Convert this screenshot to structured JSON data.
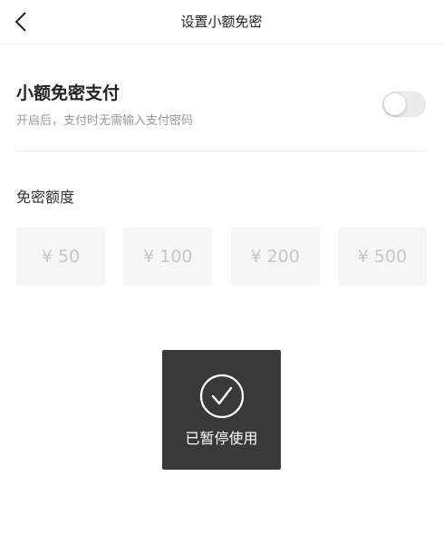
{
  "nav": {
    "back_icon": "chevron-left-icon",
    "title": "设置小额免密"
  },
  "setting": {
    "title": "小额免密支付",
    "description": "开启后，支付时无需输入支付密码",
    "toggle_on": false
  },
  "quota": {
    "label": "免密额度",
    "options": [
      "¥ 50",
      "¥ 100",
      "¥ 200",
      "¥ 500"
    ]
  },
  "toast": {
    "icon": "checkmark-circle-icon",
    "message": "已暂停使用"
  },
  "colors": {
    "toast_background": "#2e2e2e",
    "amount_text_disabled": "#c7c7c7",
    "amount_background": "#f6f6f6",
    "toggle_off": "#ececec"
  }
}
